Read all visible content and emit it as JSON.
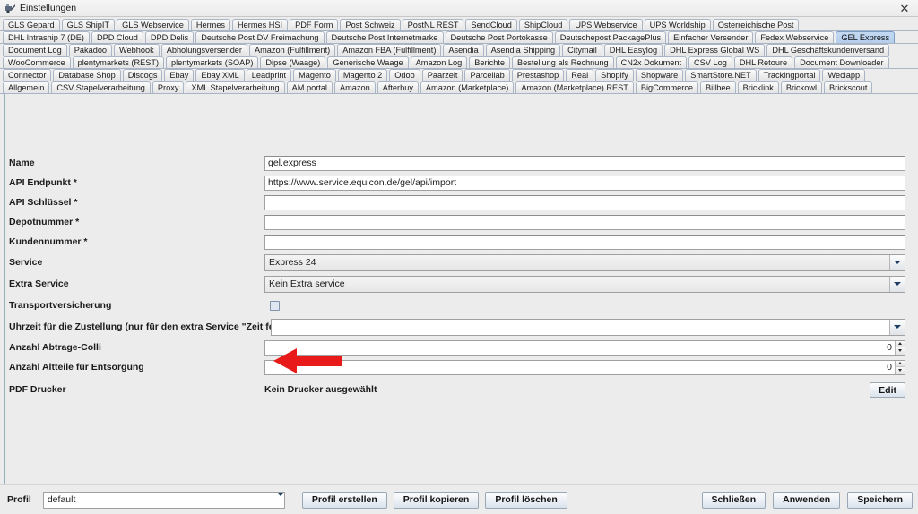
{
  "window": {
    "title": "Einstellungen",
    "app_icon": "settings-app-icon",
    "close_label": "✕"
  },
  "tab_rows": [
    {
      "tabs": [
        {
          "label": "GLS Gepard",
          "selected": false
        },
        {
          "label": "GLS ShipIT",
          "selected": false
        },
        {
          "label": "GLS Webservice",
          "selected": false
        },
        {
          "label": "Hermes",
          "selected": false
        },
        {
          "label": "Hermes HSI",
          "selected": false
        },
        {
          "label": "PDF Form",
          "selected": false
        },
        {
          "label": "Post Schweiz",
          "selected": false
        },
        {
          "label": "PostNL REST",
          "selected": false
        },
        {
          "label": "SendCloud",
          "selected": false
        },
        {
          "label": "ShipCloud",
          "selected": false
        },
        {
          "label": "UPS Webservice",
          "selected": false
        },
        {
          "label": "UPS Worldship",
          "selected": false
        },
        {
          "label": "Österreichische Post",
          "selected": false
        }
      ]
    },
    {
      "tabs": [
        {
          "label": "DHL Intraship 7 (DE)",
          "selected": false
        },
        {
          "label": "DPD Cloud",
          "selected": false
        },
        {
          "label": "DPD Delis",
          "selected": false
        },
        {
          "label": "Deutsche Post DV Freimachung",
          "selected": false
        },
        {
          "label": "Deutsche Post Internetmarke",
          "selected": false
        },
        {
          "label": "Deutsche Post Portokasse",
          "selected": false
        },
        {
          "label": "Deutschepost PackagePlus",
          "selected": false
        },
        {
          "label": "Einfacher Versender",
          "selected": false
        },
        {
          "label": "Fedex Webservice",
          "selected": false
        },
        {
          "label": "GEL Express",
          "selected": true
        }
      ]
    },
    {
      "tabs": [
        {
          "label": "Document Log",
          "selected": false
        },
        {
          "label": "Pakadoo",
          "selected": false
        },
        {
          "label": "Webhook",
          "selected": false
        },
        {
          "label": "Abholungsversender",
          "selected": false
        },
        {
          "label": "Amazon (Fulfillment)",
          "selected": false
        },
        {
          "label": "Amazon FBA (Fulfillment)",
          "selected": false
        },
        {
          "label": "Asendia",
          "selected": false
        },
        {
          "label": "Asendia Shipping",
          "selected": false
        },
        {
          "label": "Citymail",
          "selected": false
        },
        {
          "label": "DHL Easylog",
          "selected": false
        },
        {
          "label": "DHL Express Global WS",
          "selected": false
        },
        {
          "label": "DHL Geschäftskundenversand",
          "selected": false
        }
      ]
    },
    {
      "tabs": [
        {
          "label": "WooCommerce",
          "selected": false
        },
        {
          "label": "plentymarkets (REST)",
          "selected": false
        },
        {
          "label": "plentymarkets (SOAP)",
          "selected": false
        },
        {
          "label": "Dipse (Waage)",
          "selected": false
        },
        {
          "label": "Generische Waage",
          "selected": false
        },
        {
          "label": "Amazon Log",
          "selected": false
        },
        {
          "label": "Berichte",
          "selected": false
        },
        {
          "label": "Bestellung als Rechnung",
          "selected": false
        },
        {
          "label": "CN2x Dokument",
          "selected": false
        },
        {
          "label": "CSV Log",
          "selected": false
        },
        {
          "label": "DHL Retoure",
          "selected": false
        },
        {
          "label": "Document Downloader",
          "selected": false
        }
      ]
    },
    {
      "tabs": [
        {
          "label": "Connector",
          "selected": false
        },
        {
          "label": "Database Shop",
          "selected": false
        },
        {
          "label": "Discogs",
          "selected": false
        },
        {
          "label": "Ebay",
          "selected": false
        },
        {
          "label": "Ebay XML",
          "selected": false
        },
        {
          "label": "Leadprint",
          "selected": false
        },
        {
          "label": "Magento",
          "selected": false
        },
        {
          "label": "Magento 2",
          "selected": false
        },
        {
          "label": "Odoo",
          "selected": false
        },
        {
          "label": "Paarzeit",
          "selected": false
        },
        {
          "label": "Parcellab",
          "selected": false
        },
        {
          "label": "Prestashop",
          "selected": false
        },
        {
          "label": "Real",
          "selected": false
        },
        {
          "label": "Shopify",
          "selected": false
        },
        {
          "label": "Shopware",
          "selected": false
        },
        {
          "label": "SmartStore.NET",
          "selected": false
        },
        {
          "label": "Trackingportal",
          "selected": false
        },
        {
          "label": "Weclapp",
          "selected": false
        }
      ]
    },
    {
      "tabs": [
        {
          "label": "Allgemein",
          "selected": false
        },
        {
          "label": "CSV Stapelverarbeitung",
          "selected": false
        },
        {
          "label": "Proxy",
          "selected": false
        },
        {
          "label": "XML Stapelverarbeitung",
          "selected": false
        },
        {
          "label": "AM.portal",
          "selected": false
        },
        {
          "label": "Amazon",
          "selected": false
        },
        {
          "label": "Afterbuy",
          "selected": false
        },
        {
          "label": "Amazon (Marketplace)",
          "selected": false
        },
        {
          "label": "Amazon (Marketplace) REST",
          "selected": false
        },
        {
          "label": "BigCommerce",
          "selected": false
        },
        {
          "label": "Billbee",
          "selected": false
        },
        {
          "label": "Bricklink",
          "selected": false
        },
        {
          "label": "Brickowl",
          "selected": false
        },
        {
          "label": "Brickscout",
          "selected": false
        }
      ]
    }
  ],
  "form": {
    "name": {
      "label": "Name",
      "value": "gel.express",
      "placeholder": ""
    },
    "api_endpoint": {
      "label": "API Endpunkt *",
      "value": "https://www.service.equicon.de/gel/api/import",
      "placeholder": ""
    },
    "api_key": {
      "label": "API Schlüssel *",
      "value": "",
      "placeholder": ""
    },
    "depot_number": {
      "label": "Depotnummer *",
      "value": "",
      "placeholder": ""
    },
    "customer_number": {
      "label": "Kundennummer *",
      "value": "",
      "placeholder": ""
    },
    "service": {
      "label": "Service",
      "value": "Express 24",
      "options": [
        "Express 24"
      ]
    },
    "extra_service": {
      "label": "Extra Service",
      "value": "Kein Extra service",
      "options": [
        "Kein Extra service"
      ]
    },
    "transport_insurance": {
      "label": "Transportversicherung",
      "checked": false
    },
    "delivery_time": {
      "label": "Uhrzeit für die Zustellung (nur für den extra Service \"Zeit festlegen\")",
      "value": "",
      "options": []
    },
    "abtrage_colli": {
      "label": "Anzahl Abtrage-Colli",
      "value": "0"
    },
    "altteile": {
      "label": "Anzahl Altteile für Entsorgung",
      "value": "0"
    },
    "pdf_printer": {
      "label": "PDF Drucker",
      "value": "Kein Drucker ausgewählt",
      "edit_label": "Edit"
    }
  },
  "footer": {
    "profile_label": "Profil",
    "profile_value": "default",
    "profile_options": [
      "default"
    ],
    "create_profile": "Profil erstellen",
    "copy_profile": "Profil kopieren",
    "delete_profile": "Profil löschen",
    "close": "Schließen",
    "apply": "Anwenden",
    "save": "Speichern"
  },
  "annotation": {
    "arrow_color": "#e81a1a",
    "points_to": "Anzahl Abtrage-Colli"
  }
}
